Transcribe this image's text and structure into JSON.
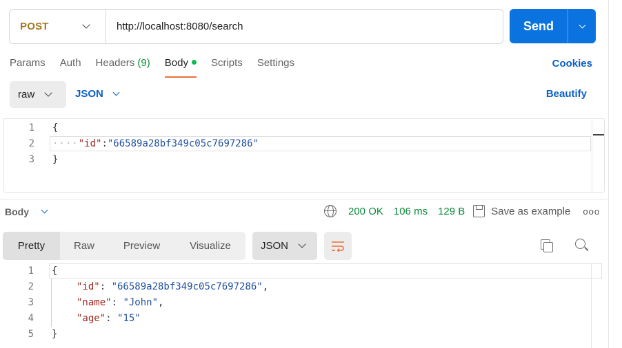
{
  "request": {
    "method": "POST",
    "url": "http://localhost:8080/search",
    "send_label": "Send"
  },
  "request_tabs": [
    {
      "label": "Params"
    },
    {
      "label": "Auth"
    },
    {
      "label": "Headers",
      "count": "(9)"
    },
    {
      "label": "Body",
      "active": true
    },
    {
      "label": "Scripts"
    },
    {
      "label": "Settings"
    }
  ],
  "cookies_label": "Cookies",
  "body_options": {
    "mode": "raw",
    "language": "JSON",
    "beautify_label": "Beautify"
  },
  "request_body": {
    "line_numbers": [
      "1",
      "2",
      "3"
    ],
    "open_brace": "{",
    "key": "\"id\"",
    "colon": ":",
    "value": "\"66589a28bf349c05c7697286\"",
    "close_brace": "}",
    "indent_marker": "····"
  },
  "response": {
    "section_label": "Body",
    "status": "200 OK",
    "time": "106 ms",
    "size": "129 B",
    "save_label": "Save as example",
    "more_label": "ooo",
    "tabs": [
      "Pretty",
      "Raw",
      "Preview",
      "Visualize"
    ],
    "format": "JSON",
    "line_numbers": [
      "1",
      "2",
      "3",
      "4",
      "5"
    ],
    "lines": {
      "l1": "{",
      "l2_key": "\"id\"",
      "l2_value": "\"66589a28bf349c05c7697286\"",
      "l3_key": "\"name\"",
      "l3_value": "\"John\"",
      "l4_key": "\"age\"",
      "l4_value": "\"15\"",
      "l5": "}",
      "sep": ": ",
      "comma": ","
    }
  },
  "colors": {
    "send": "#0b73e0",
    "method": "#a6761b",
    "link": "#0b5fc6",
    "status_ok": "#0a8a3a",
    "active_tab": "#e8703c"
  }
}
